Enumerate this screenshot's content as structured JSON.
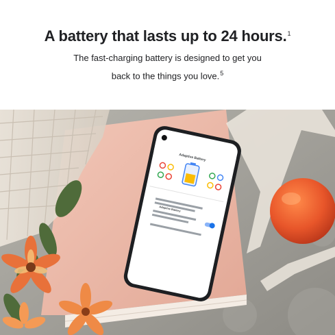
{
  "header": {
    "headline": "A battery that lasts up to 24 hours.",
    "headline_note": "1",
    "subline_1": "The fast-charging battery is designed to get you",
    "subline_2": "back to the things you love.",
    "subline_note": "5"
  },
  "phone": {
    "screen_title": "Adaptive Battery",
    "setting_label": "Adaptive Battery"
  },
  "colors": {
    "text": "#202124",
    "peach": "#e9b3a5",
    "orange": "#e8562a",
    "toggle": "#1a73e8"
  }
}
